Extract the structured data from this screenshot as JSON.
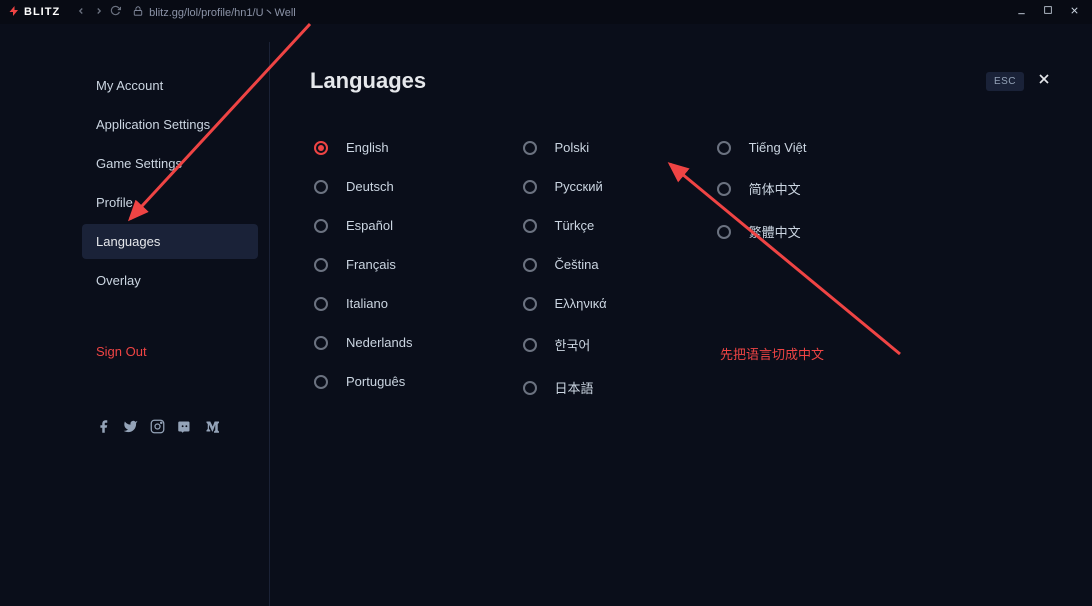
{
  "titlebar": {
    "brand": "BLITZ",
    "url": "blitz.gg/lol/profile/hn1/U丶Well"
  },
  "sidebar": {
    "items": [
      {
        "label": "My Account"
      },
      {
        "label": "Application Settings"
      },
      {
        "label": "Game Settings"
      },
      {
        "label": "Profile"
      },
      {
        "label": "Languages"
      },
      {
        "label": "Overlay"
      }
    ],
    "signout": "Sign Out"
  },
  "page": {
    "title": "Languages",
    "esc": "ESC"
  },
  "languages": {
    "col1": [
      {
        "label": "English",
        "selected": true
      },
      {
        "label": "Deutsch",
        "selected": false
      },
      {
        "label": "Español",
        "selected": false
      },
      {
        "label": "Français",
        "selected": false
      },
      {
        "label": "Italiano",
        "selected": false
      },
      {
        "label": "Nederlands",
        "selected": false
      },
      {
        "label": "Português",
        "selected": false
      }
    ],
    "col2": [
      {
        "label": "Polski",
        "selected": false
      },
      {
        "label": "Русский",
        "selected": false
      },
      {
        "label": "Türkçe",
        "selected": false
      },
      {
        "label": "Čeština",
        "selected": false
      },
      {
        "label": "Ελληνικά",
        "selected": false
      },
      {
        "label": "한국어",
        "selected": false
      },
      {
        "label": "日本語",
        "selected": false
      }
    ],
    "col3": [
      {
        "label": "Tiếng Việt",
        "selected": false
      },
      {
        "label": "简体中文",
        "selected": false
      },
      {
        "label": "繁體中文",
        "selected": false
      }
    ]
  },
  "annotation": {
    "text": "先把语言切成中文"
  }
}
